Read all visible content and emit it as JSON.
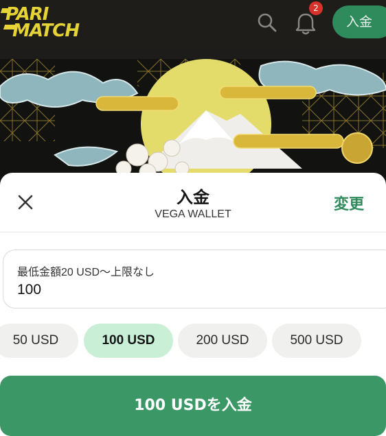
{
  "brand": {
    "logo_line1": "PARI",
    "logo_line2": "MATCH",
    "color": "#e6d335"
  },
  "header": {
    "search_icon": "search-icon",
    "bell_icon": "bell-icon",
    "notification_count": "2",
    "deposit_label": "入金"
  },
  "sheet": {
    "close_icon": "close-icon",
    "title": "入金",
    "subtitle": "VEGA WALLET",
    "change_label": "変更"
  },
  "amount": {
    "label": "最低金額20 USD～上限なし",
    "value": "100"
  },
  "presets": [
    {
      "label": "50 USD",
      "selected": false
    },
    {
      "label": "100 USD",
      "selected": true
    },
    {
      "label": "200 USD",
      "selected": false
    },
    {
      "label": "500 USD",
      "selected": false
    }
  ],
  "cta": {
    "label": "100 USDを入金"
  },
  "colors": {
    "accent": "#2f8a5c",
    "cta": "#3b9866",
    "chip_active": "#c9f0d7",
    "badge": "#d7332c"
  }
}
